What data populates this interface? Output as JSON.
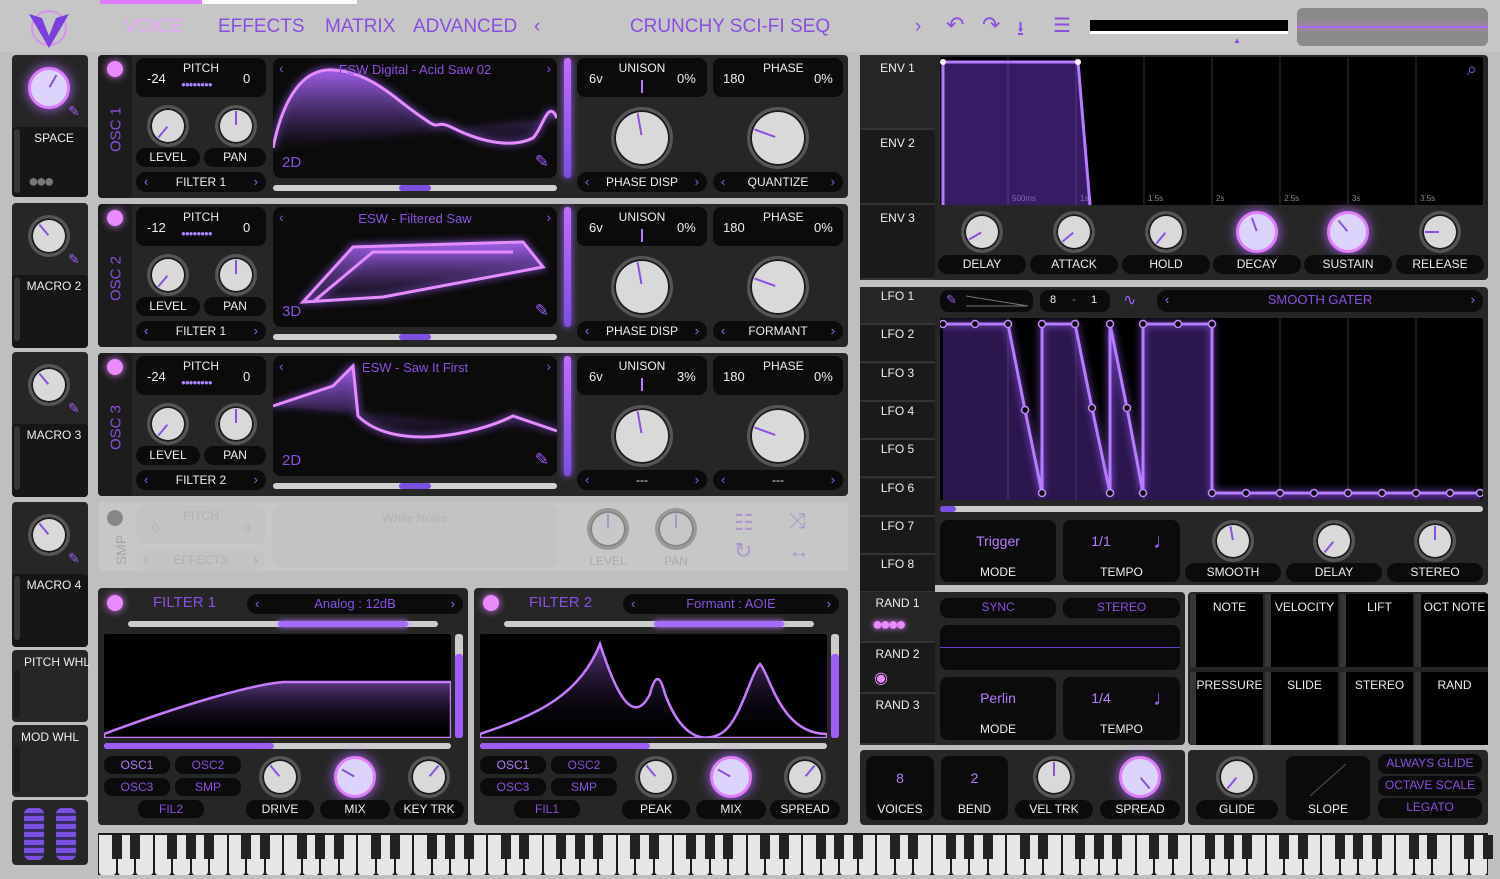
{
  "topbar": {
    "tabs": [
      "VOICE",
      "EFFECTS",
      "MATRIX",
      "ADVANCED"
    ],
    "preset_name": "CRUNCHY SCI-FI SEQ",
    "icons": [
      "prev-preset-icon",
      "next-preset-icon",
      "undo-icon",
      "redo-icon",
      "save-icon",
      "menu-icon"
    ]
  },
  "macros": [
    {
      "label": "SPACE"
    },
    {
      "label": "MACRO 2"
    },
    {
      "label": "MACRO 3"
    },
    {
      "label": "MACRO 4"
    }
  ],
  "wheels": {
    "pitch": "PITCH WHL",
    "mod": "MOD WHL"
  },
  "osc": [
    {
      "label": "OSC 1",
      "pitch_label": "PITCH",
      "pitch_lo": "-24",
      "pitch_hi": "0",
      "wavetable": "ESW Digital - Acid Saw 02",
      "dim": "2D",
      "level": "LEVEL",
      "pan": "PAN",
      "filter": "FILTER 1",
      "unison_label": "UNISON",
      "voices": "6v",
      "detune": "0%",
      "phase_label": "PHASE",
      "phase": "180",
      "phase_pct": "0%",
      "sel1": "PHASE DISP",
      "sel2": "QUANTIZE"
    },
    {
      "label": "OSC 2",
      "pitch_label": "PITCH",
      "pitch_lo": "-12",
      "pitch_hi": "0",
      "wavetable": "ESW - Filtered Saw",
      "dim": "3D",
      "level": "LEVEL",
      "pan": "PAN",
      "filter": "FILTER 1",
      "unison_label": "UNISON",
      "voices": "6v",
      "detune": "0%",
      "phase_label": "PHASE",
      "phase": "180",
      "phase_pct": "0%",
      "sel1": "PHASE DISP",
      "sel2": "FORMANT"
    },
    {
      "label": "OSC 3",
      "pitch_label": "PITCH",
      "pitch_lo": "-24",
      "pitch_hi": "0",
      "wavetable": "ESW - Saw It First",
      "dim": "2D",
      "level": "LEVEL",
      "pan": "PAN",
      "filter": "FILTER 2",
      "unison_label": "UNISON",
      "voices": "6v",
      "detune": "3%",
      "phase_label": "PHASE",
      "phase": "180",
      "phase_pct": "0%",
      "sel1": "---",
      "sel2": "---"
    }
  ],
  "smp": {
    "label": "SMP",
    "pitch_label": "PITCH",
    "pitch_lo": "0",
    "pitch_hi": "0",
    "sample": "White Noise",
    "dest": "EFFECTS",
    "level": "LEVEL",
    "pan": "PAN"
  },
  "filters": [
    {
      "title": "FILTER 1",
      "model": "Analog : 12dB",
      "src": [
        "OSC1",
        "OSC2",
        "OSC3",
        "SMP"
      ],
      "other": "FIL2",
      "knobs": [
        "DRIVE",
        "MIX",
        "KEY TRK"
      ]
    },
    {
      "title": "FILTER 2",
      "model": "Formant : AOIE",
      "src": [
        "OSC1",
        "OSC2",
        "OSC3",
        "SMP"
      ],
      "other": "FIL1",
      "knobs": [
        "PEAK",
        "MIX",
        "SPREAD"
      ]
    }
  ],
  "env": {
    "tabs": [
      "ENV 1",
      "ENV 2",
      "ENV 3"
    ],
    "time_labels": [
      "500ms",
      "1s",
      "1.5s",
      "2s",
      "2.5s",
      "3s",
      "3.5s"
    ],
    "knobs": [
      "DELAY",
      "ATTACK",
      "HOLD",
      "DECAY",
      "SUSTAIN",
      "RELEASE"
    ]
  },
  "lfo": {
    "tabs": [
      "LFO 1",
      "LFO 2",
      "LFO 3",
      "LFO 4",
      "LFO 5",
      "LFO 6",
      "LFO 7",
      "LFO 8"
    ],
    "grid_x": "8",
    "grid_sep": "-",
    "grid_y": "1",
    "preset": "SMOOTH GATER",
    "mode_value": "Trigger",
    "mode_label": "MODE",
    "tempo_value": "1/1",
    "tempo_label": "TEMPO",
    "knobs": [
      "SMOOTH",
      "DELAY",
      "STEREO"
    ]
  },
  "rand": {
    "tabs": [
      "RAND 1",
      "RAND 2",
      "RAND 3"
    ],
    "sync": "SYNC",
    "stereo": "STEREO",
    "mode_value": "Perlin",
    "mode_label": "MODE",
    "tempo_value": "1/4",
    "tempo_label": "TEMPO"
  },
  "sources": [
    "NOTE",
    "VELOCITY",
    "LIFT",
    "OCT NOTE",
    "PRESSURE",
    "SLIDE",
    "STEREO",
    "RAND"
  ],
  "voice": {
    "voices_value": "8",
    "voices_label": "VOICES",
    "bend_value": "2",
    "bend_label": "BEND",
    "veltrk": "VEL TRK",
    "spread": "SPREAD"
  },
  "glide": {
    "glide": "GLIDE",
    "slope": "SLOPE",
    "always": "ALWAYS GLIDE",
    "octave": "OCTAVE SCALE",
    "legato": "LEGATO"
  },
  "colors": {
    "accent": "#9d5cf5",
    "highlight": "#e07cff",
    "panel": "#262626",
    "background": "#bfbfbf"
  }
}
